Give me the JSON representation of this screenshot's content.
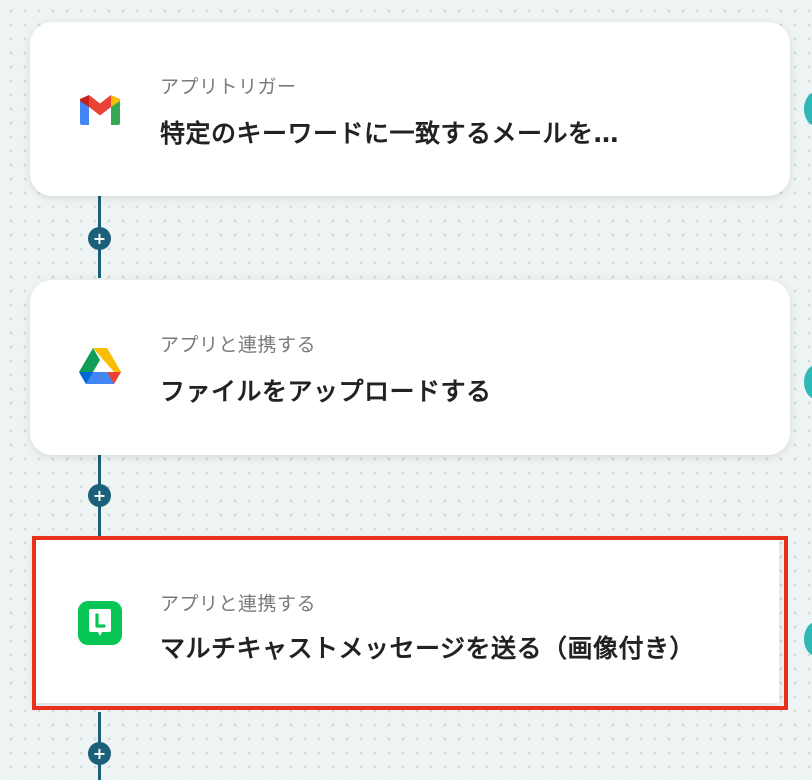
{
  "flow": {
    "steps": [
      {
        "subtitle": "アプリトリガー",
        "title": "特定のキーワードに一致するメールを…",
        "icon": "gmail-icon"
      },
      {
        "subtitle": "アプリと連携する",
        "title": "ファイルをアップロードする",
        "icon": "google-drive-icon"
      },
      {
        "subtitle": "アプリと連携する",
        "title": "マルチキャストメッセージを送る（画像付き）",
        "icon": "line-icon",
        "selected": true
      }
    ],
    "add_button_label": "+"
  },
  "colors": {
    "connector": "#1b5f78",
    "highlight": "#e8311a",
    "side_status": "#2eb8b8"
  }
}
